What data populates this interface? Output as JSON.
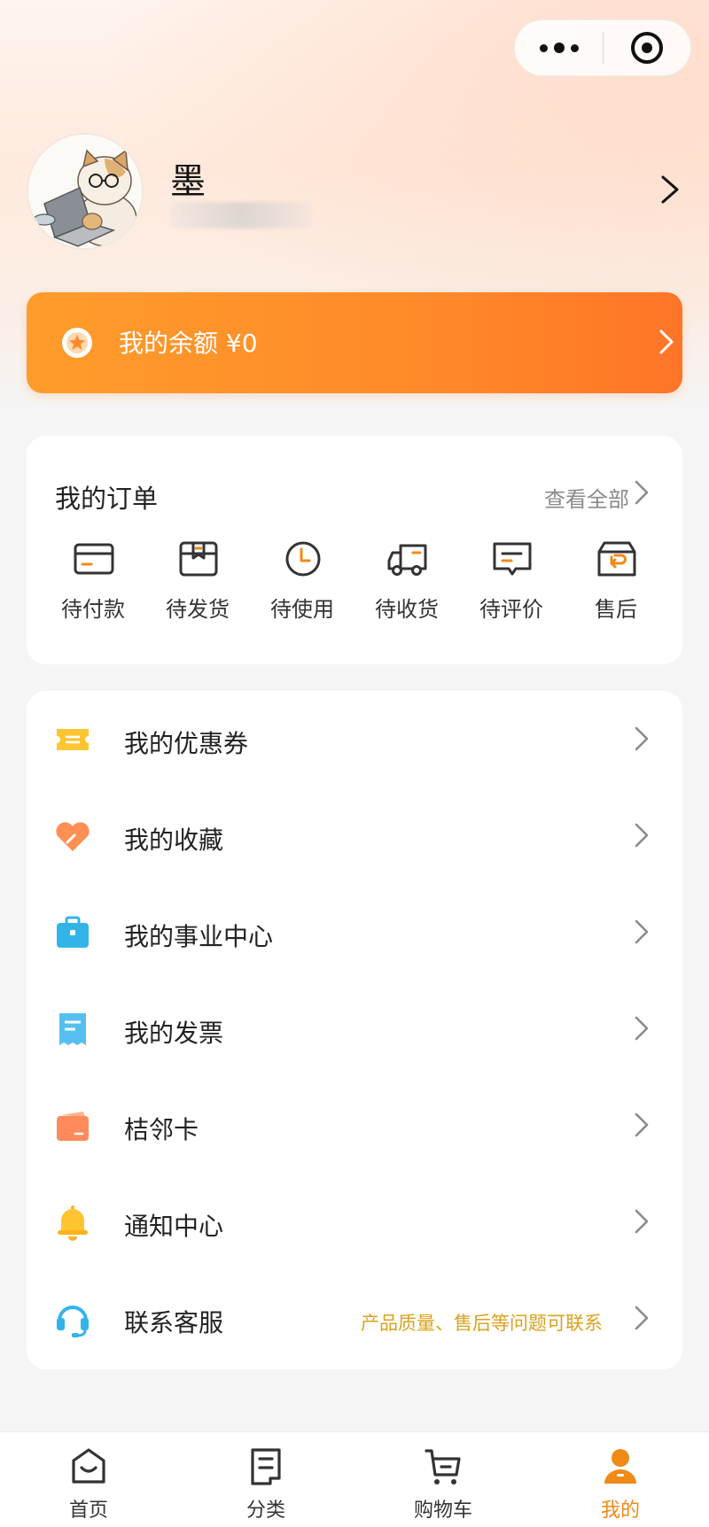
{
  "capsule": {
    "more_icon": "more-dots-icon",
    "close_icon": "target-close-icon"
  },
  "profile": {
    "name": "墨"
  },
  "balance": {
    "label": "我的余额 ¥0",
    "icon": "coin-icon",
    "accent": "#ff8a29"
  },
  "orders": {
    "title": "我的订单",
    "view_all": "查看全部",
    "items": [
      {
        "label": "待付款",
        "icon": "card-icon"
      },
      {
        "label": "待发货",
        "icon": "package-icon"
      },
      {
        "label": "待使用",
        "icon": "clock-icon"
      },
      {
        "label": "待收货",
        "icon": "truck-icon"
      },
      {
        "label": "待评价",
        "icon": "chat-icon"
      },
      {
        "label": "售后",
        "icon": "return-box-icon"
      }
    ]
  },
  "menu": {
    "items": [
      {
        "label": "我的优惠券",
        "icon": "coupon-icon",
        "note": ""
      },
      {
        "label": "我的收藏",
        "icon": "heart-icon",
        "note": ""
      },
      {
        "label": "我的事业中心",
        "icon": "briefcase-icon",
        "note": ""
      },
      {
        "label": "我的发票",
        "icon": "invoice-icon",
        "note": ""
      },
      {
        "label": "桔邻卡",
        "icon": "wallet-card-icon",
        "note": ""
      },
      {
        "label": "通知中心",
        "icon": "bell-icon",
        "note": ""
      },
      {
        "label": "联系客服",
        "icon": "headset-icon",
        "note": "产品质量、售后等问题可联系"
      }
    ],
    "note_color": "#d9a21f"
  },
  "tabbar": {
    "items": [
      {
        "label": "首页",
        "icon": "home-icon"
      },
      {
        "label": "分类",
        "icon": "category-icon"
      },
      {
        "label": "购物车",
        "icon": "cart-icon"
      },
      {
        "label": "我的",
        "icon": "profile-icon",
        "active": true
      }
    ],
    "active_color": "#f08a17"
  }
}
